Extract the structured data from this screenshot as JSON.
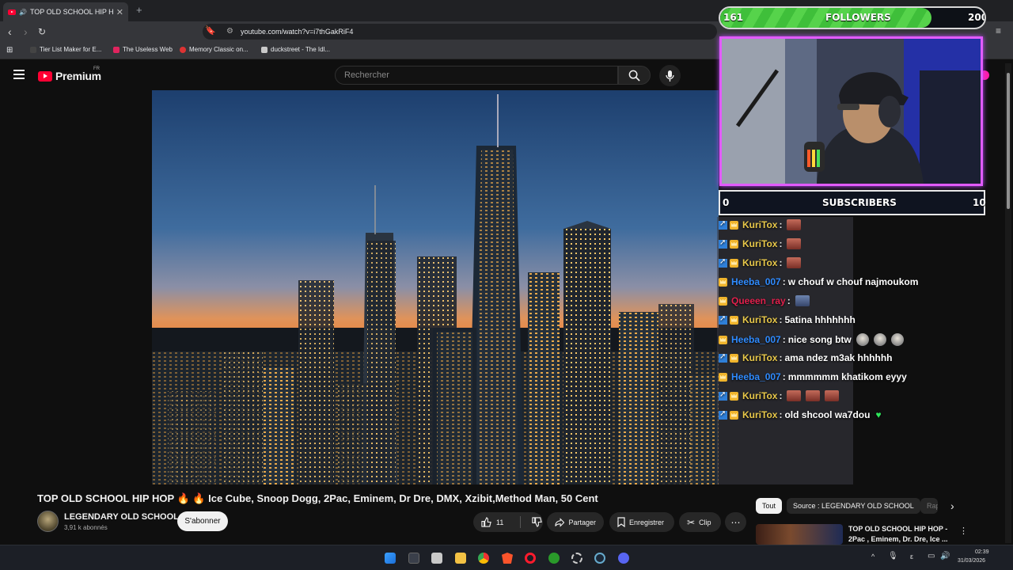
{
  "browser": {
    "tab_title": "TOP OLD SCHOOL HIP HOP 🔥",
    "url": "youtube.com/watch?v=i7thGakRiF4",
    "bookmarks": [
      "Tier List Maker for E...",
      "The Useless Web",
      "Memory Classic on...",
      "duckstreet - The Idl..."
    ]
  },
  "youtube": {
    "logo_text": "Premium",
    "region": "FR",
    "search_placeholder": "Rechercher",
    "video_title": "TOP OLD SCHOOL HIP HOP 🔥 🔥 Ice Cube, Snoop Dogg, 2Pac, Eminem, Dr Dre, DMX, Xzibit,Method Man, 50 Cent",
    "channel_name": "LEGENDARY OLD SCHOOL",
    "channel_subs": "3,91 k abonnés",
    "subscribe_label": "S'abonner",
    "like_count": "11",
    "share_label": "Partager",
    "save_label": "Enregistrer",
    "clip_label": "Clip",
    "filter_chips": [
      "Tout",
      "Source : LEGENDARY OLD SCHOOL",
      "Rap"
    ],
    "suggested_title": "TOP OLD SCHOOL HIP HOP - 2Pac , Eminem, Dr. Dre, Ice ..."
  },
  "overlay": {
    "followers_current": "161",
    "followers_label": "FOLLOWERS",
    "followers_goal": "200",
    "followers_progress": 0.8,
    "subscribers_current": "0",
    "subscribers_label": "SUBSCRIBERS",
    "subscribers_goal": "10",
    "chat": [
      {
        "user": "KuriTox",
        "user_color": "#e8c84a",
        "badges": [
          "prime",
          "crown"
        ],
        "text": "",
        "emotes": [
          "fire"
        ]
      },
      {
        "user": "KuriTox",
        "user_color": "#e8c84a",
        "badges": [
          "prime",
          "crown"
        ],
        "text": "",
        "emotes": [
          "fire"
        ]
      },
      {
        "user": "KuriTox",
        "user_color": "#e8c84a",
        "badges": [
          "prime",
          "crown"
        ],
        "text": "",
        "emotes": [
          "fire"
        ]
      },
      {
        "user": "Heeba_007",
        "user_color": "#2f8bff",
        "badges": [
          "crown"
        ],
        "text": "w chouf w chouf najmoukom",
        "emotes": []
      },
      {
        "user": "Queeen_ray",
        "user_color": "#e0204c",
        "badges": [
          "crown"
        ],
        "text": "",
        "emotes": [
          "cat"
        ]
      },
      {
        "user": "KuriTox",
        "user_color": "#e8c84a",
        "badges": [
          "prime",
          "crown"
        ],
        "text": "5atina hhhhhhh",
        "emotes": []
      },
      {
        "user": "Heeba_007",
        "user_color": "#2f8bff",
        "badges": [
          "crown"
        ],
        "text": "nice song btw",
        "emotes": [
          "meme",
          "meme",
          "meme"
        ]
      },
      {
        "user": "KuriTox",
        "user_color": "#e8c84a",
        "badges": [
          "prime",
          "crown"
        ],
        "text": "ama ndez m3ak hhhhhh",
        "emotes": []
      },
      {
        "user": "Heeba_007",
        "user_color": "#2f8bff",
        "badges": [
          "crown"
        ],
        "text": "mmmmmm khatikom eyyy",
        "emotes": []
      },
      {
        "user": "KuriTox",
        "user_color": "#e8c84a",
        "badges": [
          "prime",
          "crown"
        ],
        "text": "",
        "emotes": [
          "fire",
          "fire",
          "fire"
        ]
      },
      {
        "user": "KuriTox",
        "user_color": "#e8c84a",
        "badges": [
          "prime",
          "crown"
        ],
        "text": "old shcool wa7dou",
        "emotes": [
          "heart"
        ]
      }
    ]
  },
  "taskbar": {
    "time": "02:39",
    "date": "31/03/2026"
  }
}
